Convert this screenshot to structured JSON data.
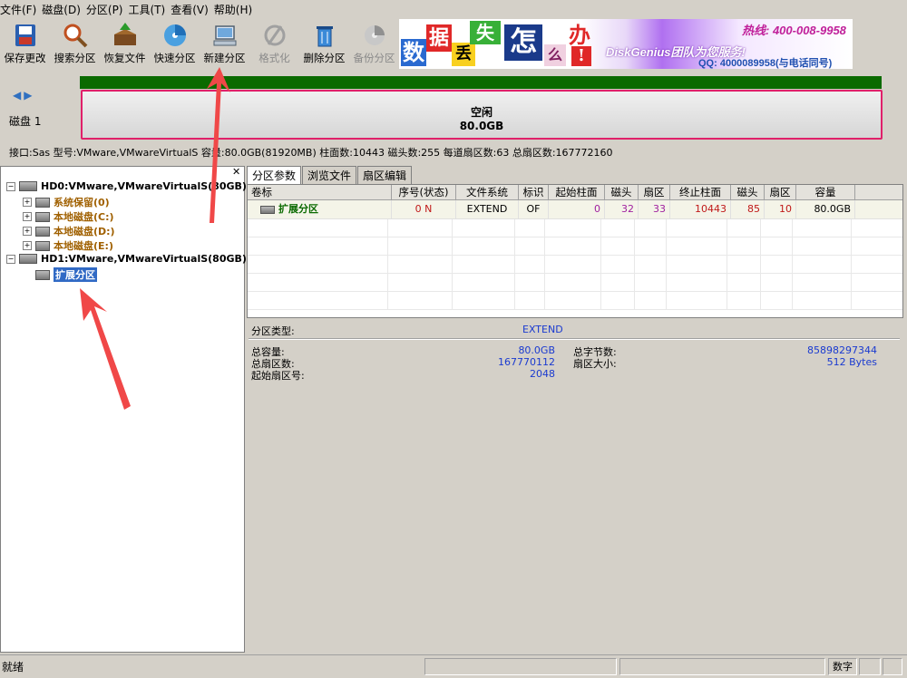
{
  "menu": [
    "文件(F)",
    "磁盘(D)",
    "分区(P)",
    "工具(T)",
    "查看(V)",
    "帮助(H)"
  ],
  "toolbar": [
    {
      "label": "保存更改",
      "icon": "save-icon",
      "enabled": true
    },
    {
      "label": "搜索分区",
      "icon": "magnifier-icon",
      "enabled": true
    },
    {
      "label": "恢复文件",
      "icon": "recover-box-icon",
      "enabled": true
    },
    {
      "label": "快速分区",
      "icon": "disc-icon",
      "enabled": true
    },
    {
      "label": "新建分区",
      "icon": "computer-icon",
      "enabled": true
    },
    {
      "label": "格式化",
      "icon": "format-icon",
      "enabled": false
    },
    {
      "label": "删除分区",
      "icon": "trash-icon",
      "enabled": true
    },
    {
      "label": "备份分区",
      "icon": "backup-disc-icon",
      "enabled": false
    }
  ],
  "banner": {
    "chars": [
      "数",
      "据",
      "丢",
      "失",
      "怎",
      "么",
      "办",
      "!"
    ],
    "slogan": "DiskGenius团队为您服务!",
    "hotline": "热线: 400-008-9958",
    "qq": "QQ: 4000089958(与电话同号)"
  },
  "disk_panel": {
    "disk_label": "磁盘 1",
    "bar_status": "空闲",
    "bar_size": "80.0GB",
    "info": "接口:Sas  型号:VMware,VMwareVirtualS  容量:80.0GB(81920MB)  柱面数:10443  磁头数:255  每道扇区数:63  总扇区数:167772160"
  },
  "tree": {
    "hd0": "HD0:VMware,VMwareVirtualS(80GB)",
    "hd0_parts": [
      "系统保留(0)",
      "本地磁盘(C:)",
      "本地磁盘(D:)",
      "本地磁盘(E:)"
    ],
    "hd1": "HD1:VMware,VMwareVirtualS(80GB)",
    "hd1_selected": "扩展分区"
  },
  "tabs": [
    "分区参数",
    "浏览文件",
    "扇区编辑"
  ],
  "table": {
    "headers": [
      "卷标",
      "序号(状态)",
      "文件系统",
      "标识",
      "起始柱面",
      "磁头",
      "扇区",
      "终止柱面",
      "磁头",
      "扇区",
      "容量"
    ],
    "row": [
      "扩展分区",
      "0 N",
      "EXTEND",
      "OF",
      "0",
      "32",
      "33",
      "10443",
      "85",
      "10",
      "80.0GB"
    ]
  },
  "details": {
    "type_label": "分区类型:",
    "type_value": "EXTEND",
    "total_cap_label": "总容量:",
    "total_cap_value": "80.0GB",
    "total_sectors_label": "总扇区数:",
    "total_sectors_value": "167770112",
    "start_sector_label": "起始扇区号:",
    "start_sector_value": "2048",
    "total_bytes_label": "总字节数:",
    "total_bytes_value": "85898297344",
    "sector_size_label": "扇区大小:",
    "sector_size_value": "512 Bytes"
  },
  "status": {
    "left": "就绪",
    "mode": "数字"
  },
  "colors": {
    "accent_pink": "#e0206a",
    "green_bar": "#0b6a00",
    "arrow": "#f04848",
    "selection": "#316ac5"
  }
}
